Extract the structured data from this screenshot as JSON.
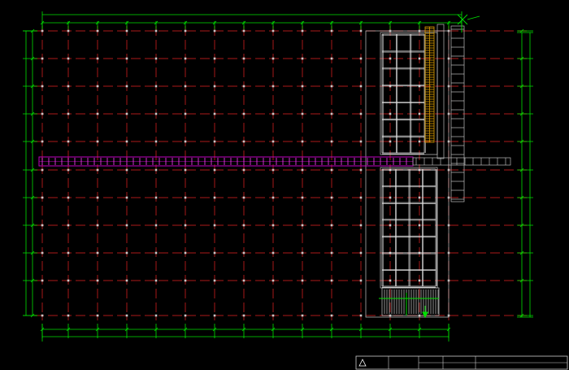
{
  "drawing": {
    "colors": {
      "background": "#000000",
      "grid_red": "#7a1212",
      "grid_red_bright": "#a81818",
      "dimension_green": "#00e000",
      "column_white": "#d8d8d8",
      "beam_magenta": "#c000c0",
      "stair_yellow": "#d89a00",
      "title_yellow": "#e6e600"
    },
    "dimension_texts": {
      "top_overall": "",
      "bottom_overall": "",
      "left_overall": "",
      "right_overall": ""
    },
    "title_block": {
      "drawing_name": "",
      "company": "",
      "company_en": "",
      "left_row1": "",
      "left_row2": "",
      "mid_row1": "",
      "mid_row2": ""
    },
    "icons": {
      "north_marker": "cross-marker-icon",
      "stair_arrow": "arrow-icon"
    }
  }
}
